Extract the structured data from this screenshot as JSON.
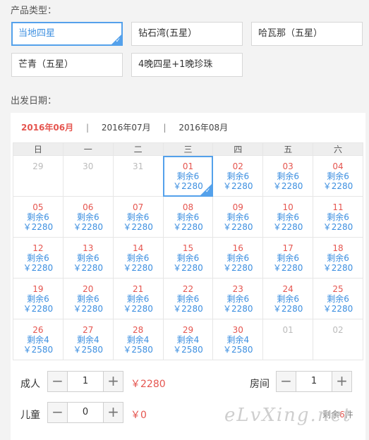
{
  "product_type_label": "产品类型：",
  "products": [
    {
      "label": "当地四星",
      "selected": true
    },
    {
      "label": "钻石湾(五星）",
      "selected": false
    },
    {
      "label": "哈瓦那（五星）",
      "selected": false
    },
    {
      "label": "芒青（五星）",
      "selected": false
    },
    {
      "label": "4晚四星+1晚珍珠",
      "selected": false
    }
  ],
  "departure_label": "出发日期：",
  "months": [
    {
      "label": "2016年06月",
      "active": true
    },
    {
      "label": "2016年07月",
      "active": false
    },
    {
      "label": "2016年08月",
      "active": false
    }
  ],
  "month_separator": "|",
  "weekdays": [
    "日",
    "一",
    "二",
    "三",
    "四",
    "五",
    "六"
  ],
  "calendar": [
    [
      {
        "day": "29",
        "muted": true
      },
      {
        "day": "30",
        "muted": true
      },
      {
        "day": "31",
        "muted": true
      },
      {
        "day": "01",
        "remain": "剩余6",
        "price": "￥2280",
        "selected": true
      },
      {
        "day": "02",
        "remain": "剩余6",
        "price": "￥2280"
      },
      {
        "day": "03",
        "remain": "剩余6",
        "price": "￥2280"
      },
      {
        "day": "04",
        "remain": "剩余6",
        "price": "￥2280"
      }
    ],
    [
      {
        "day": "05",
        "remain": "剩余6",
        "price": "￥2280"
      },
      {
        "day": "06",
        "remain": "剩余6",
        "price": "￥2280"
      },
      {
        "day": "07",
        "remain": "剩余6",
        "price": "￥2280"
      },
      {
        "day": "08",
        "remain": "剩余6",
        "price": "￥2280"
      },
      {
        "day": "09",
        "remain": "剩余6",
        "price": "￥2280"
      },
      {
        "day": "10",
        "remain": "剩余6",
        "price": "￥2280"
      },
      {
        "day": "11",
        "remain": "剩余6",
        "price": "￥2280"
      }
    ],
    [
      {
        "day": "12",
        "remain": "剩余6",
        "price": "￥2280"
      },
      {
        "day": "13",
        "remain": "剩余6",
        "price": "￥2280"
      },
      {
        "day": "14",
        "remain": "剩余6",
        "price": "￥2280"
      },
      {
        "day": "15",
        "remain": "剩余6",
        "price": "￥2280"
      },
      {
        "day": "16",
        "remain": "剩余6",
        "price": "￥2280"
      },
      {
        "day": "17",
        "remain": "剩余6",
        "price": "￥2280"
      },
      {
        "day": "18",
        "remain": "剩余6",
        "price": "￥2280"
      }
    ],
    [
      {
        "day": "19",
        "remain": "剩余6",
        "price": "￥2280"
      },
      {
        "day": "20",
        "remain": "剩余6",
        "price": "￥2280"
      },
      {
        "day": "21",
        "remain": "剩余6",
        "price": "￥2280"
      },
      {
        "day": "22",
        "remain": "剩余6",
        "price": "￥2280"
      },
      {
        "day": "23",
        "remain": "剩余6",
        "price": "￥2280"
      },
      {
        "day": "24",
        "remain": "剩余6",
        "price": "￥2280"
      },
      {
        "day": "25",
        "remain": "剩余6",
        "price": "￥2280"
      }
    ],
    [
      {
        "day": "26",
        "remain": "剩余4",
        "price": "￥2580"
      },
      {
        "day": "27",
        "remain": "剩余4",
        "price": "￥2580"
      },
      {
        "day": "28",
        "remain": "剩余4",
        "price": "￥2580"
      },
      {
        "day": "29",
        "remain": "剩余4",
        "price": "￥2580"
      },
      {
        "day": "30",
        "remain": "剩余4",
        "price": "￥2580"
      },
      {
        "day": "01",
        "muted": true
      },
      {
        "day": "02",
        "muted": true
      }
    ]
  ],
  "adults": {
    "label": "成人",
    "minus": "−",
    "value": "1",
    "plus": "+",
    "price": "￥2280"
  },
  "children": {
    "label": "儿童",
    "minus": "−",
    "value": "0",
    "plus": "+",
    "price": "￥0"
  },
  "rooms": {
    "label": "房间",
    "minus": "−",
    "value": "1",
    "plus": "+"
  },
  "remaining": {
    "prefix": "剩余",
    "count": "6",
    "suffix": "件"
  },
  "check_symbol": "✓",
  "watermark": "eLvXing.net"
}
